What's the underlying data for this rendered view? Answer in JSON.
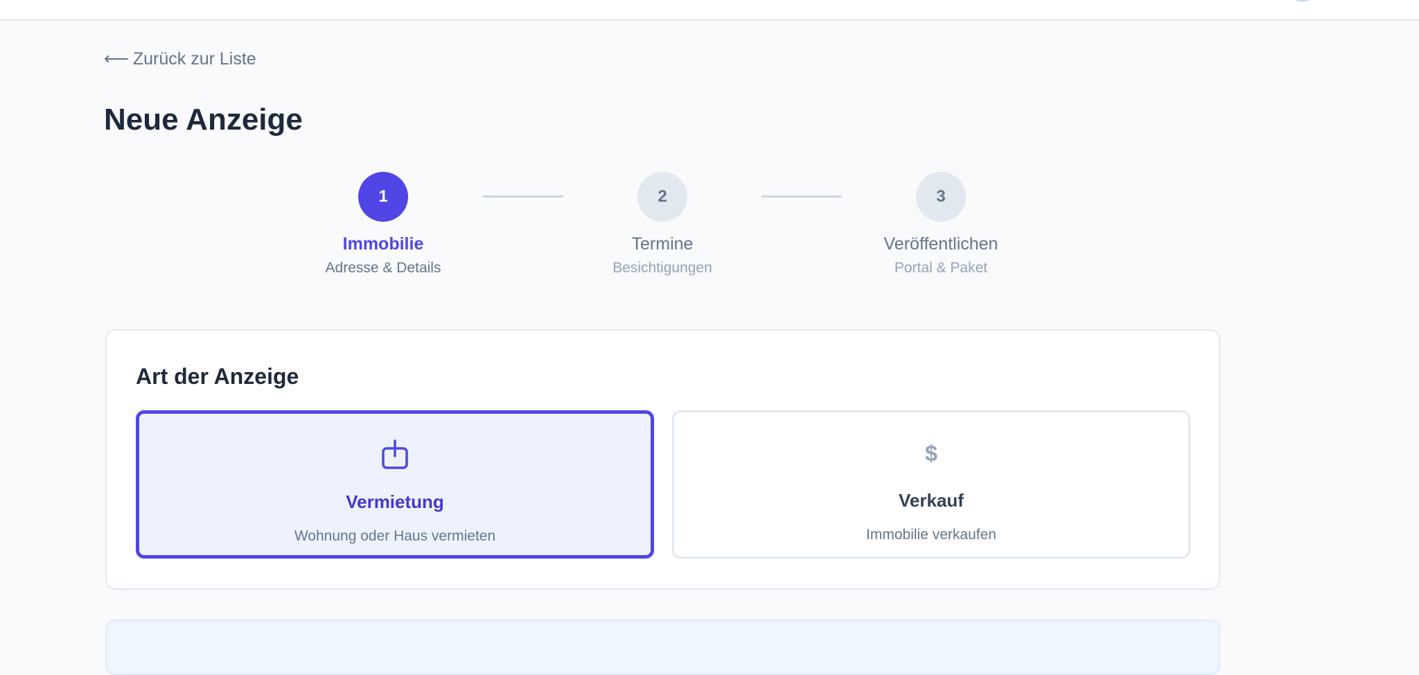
{
  "nav": {
    "back_arrow": "⟵",
    "back_label": "Zurück zur Liste"
  },
  "page": {
    "title": "Neue Anzeige"
  },
  "stepper": {
    "steps": [
      {
        "number": "1",
        "label": "Immobilie",
        "sub": "Adresse & Details",
        "state": "active"
      },
      {
        "number": "2",
        "label": "Termine",
        "sub": "Besichtigungen",
        "state": "pending"
      },
      {
        "number": "3",
        "label": "Veröffentlichen",
        "sub": "Portal & Paket",
        "state": "pending"
      }
    ]
  },
  "listing_type": {
    "title": "Art der Anzeige",
    "options": [
      {
        "title": "Vermietung",
        "sub": "Wohnung oder Haus vermieten",
        "icon": "rent-box-icon",
        "selected": true
      },
      {
        "title": "Verkauf",
        "sub": "Immobilie verkaufen",
        "icon": "dollar-icon",
        "symbol": "$",
        "selected": false
      }
    ]
  },
  "colors": {
    "accent": "#4f46e5",
    "background": "#f8fafc",
    "border": "#e2e8f0",
    "selected_bg": "#eef2ff",
    "info_bg": "#eff6ff"
  }
}
